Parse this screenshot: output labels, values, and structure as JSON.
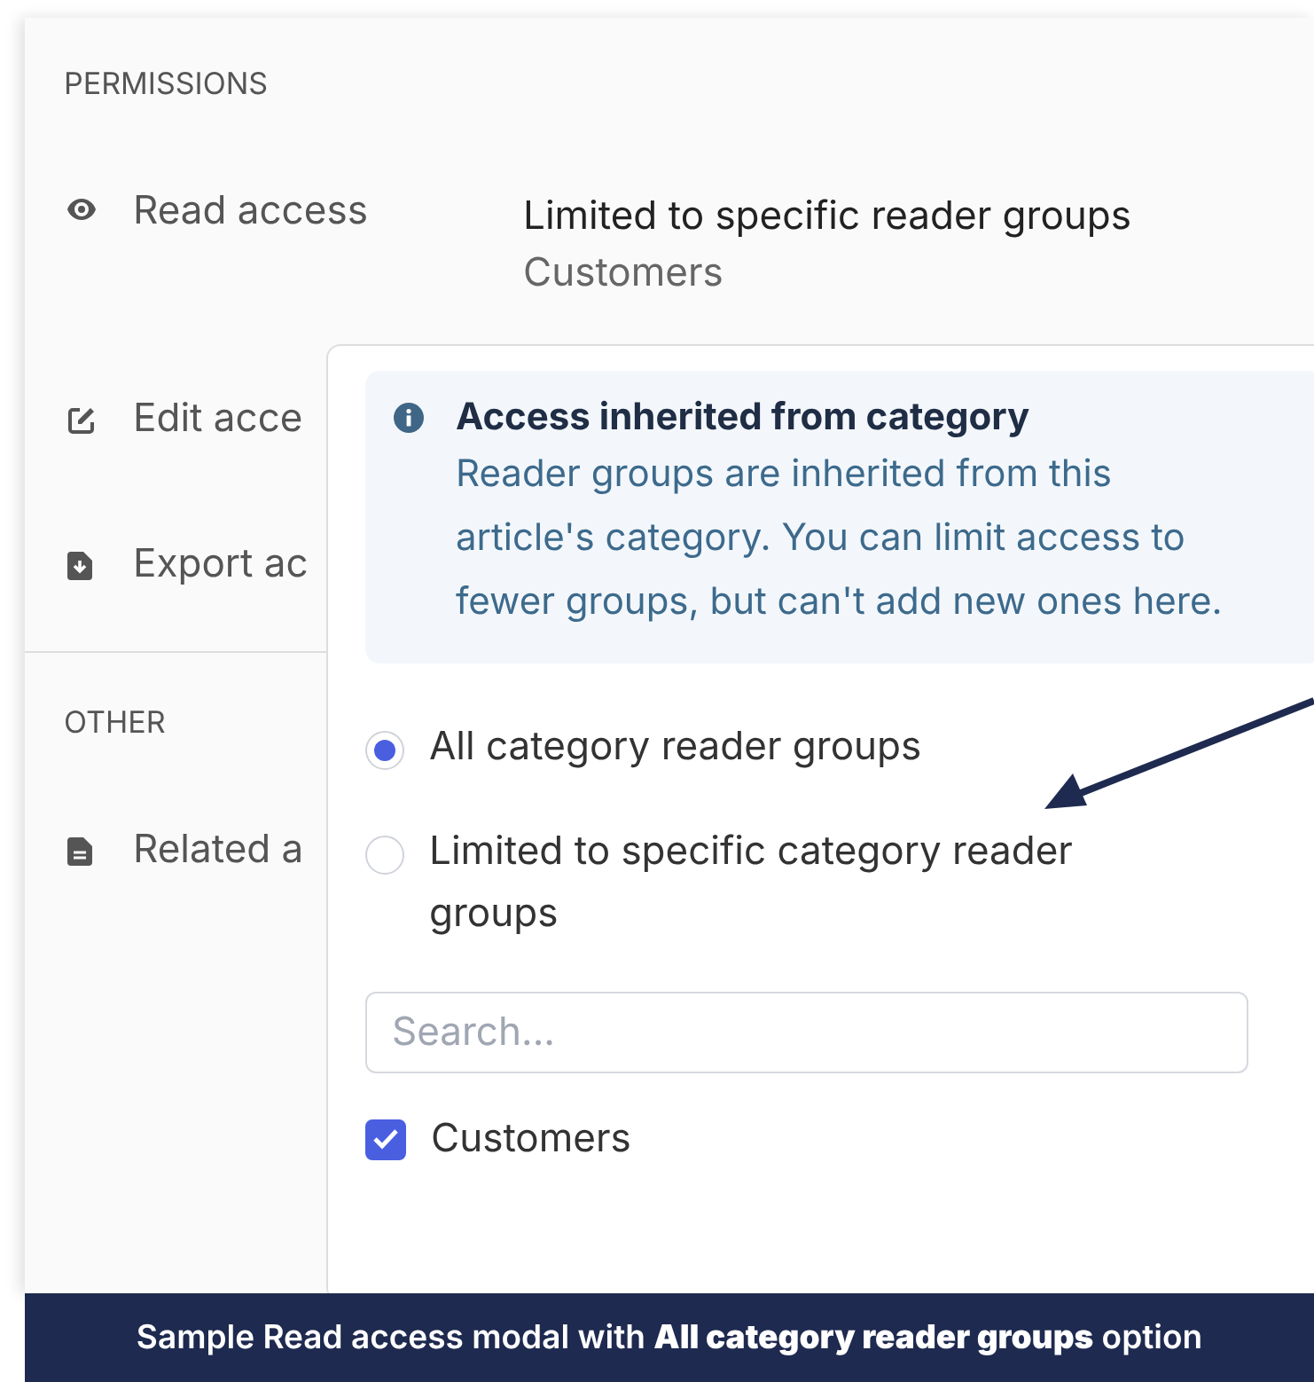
{
  "permissions": {
    "heading": "PERMISSIONS",
    "items": [
      {
        "kind": "read",
        "label": "Read access",
        "value": "Limited to specific reader groups",
        "detail": "Customers"
      },
      {
        "kind": "edit",
        "label": "Edit acce"
      },
      {
        "kind": "export",
        "label": "Export ac"
      }
    ]
  },
  "other": {
    "heading": "OTHER",
    "items": [
      {
        "kind": "related",
        "label": "Related a"
      }
    ]
  },
  "modal": {
    "notice": {
      "title": "Access inherited from category",
      "body": "Reader groups are inherited from this article's category. You can limit access to fewer groups, but can't add new ones here."
    },
    "options": [
      {
        "label": "All category reader groups",
        "selected": true
      },
      {
        "label": "Limited to specific category reader groups",
        "selected": false
      }
    ],
    "search": {
      "placeholder": "Search..."
    },
    "groups": [
      {
        "label": "Customers",
        "checked": true
      }
    ]
  },
  "caption": "Sample Read access modal with **All category reader groups** option"
}
